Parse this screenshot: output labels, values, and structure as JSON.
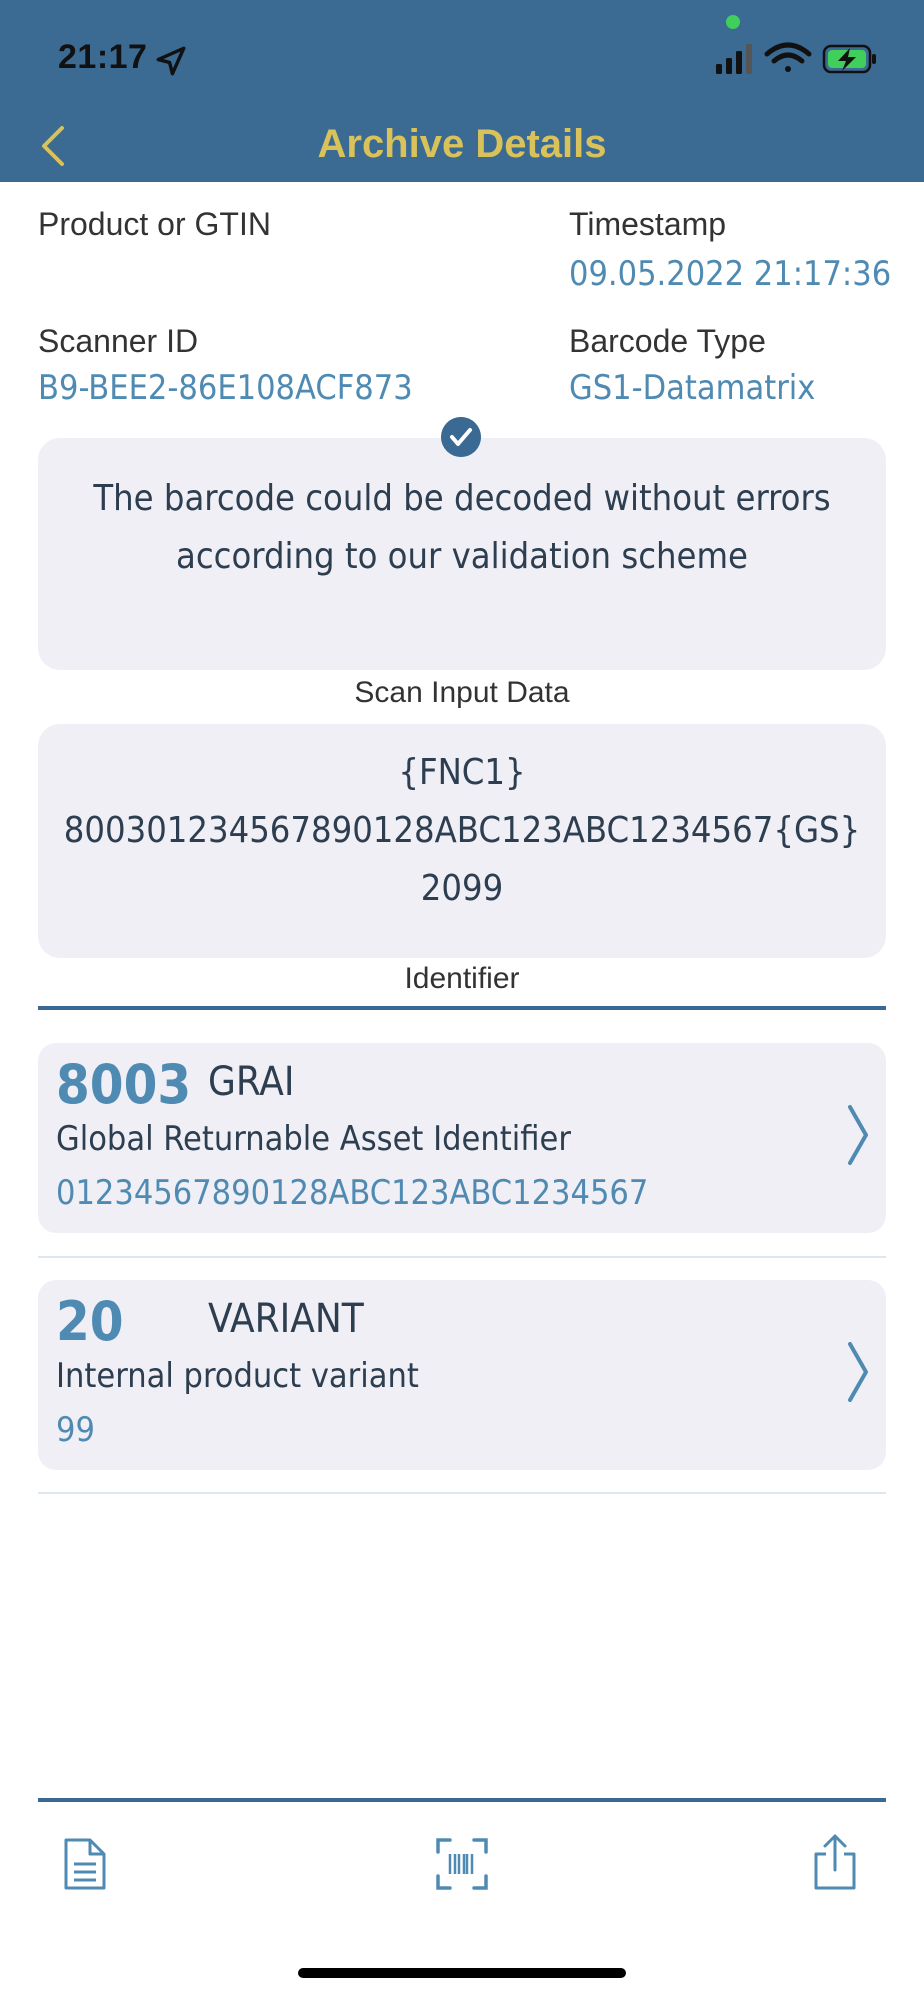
{
  "colors": {
    "nav_bg": "#3b6a93",
    "title": "#d9c25a",
    "accent": "#4f8ab3"
  },
  "status_bar": {
    "time": "21:17"
  },
  "nav": {
    "title": "Archive Details"
  },
  "info": {
    "product_label": "Product or GTIN",
    "timestamp_label": "Timestamp",
    "timestamp_value": "09.05.2022 21:17:36",
    "scanner_label": "Scanner ID",
    "scanner_value": "B9-BEE2-86E108ACF873",
    "barcode_type_label": "Barcode Type",
    "barcode_type_value": "GS1-Datamatrix"
  },
  "validation": {
    "line1": "The barcode could be decoded without errors",
    "line2": "according to our validation scheme"
  },
  "scan_input": {
    "label": "Scan Input Data",
    "line1": "{FNC1}",
    "line2": "800301234567890128ABC123ABC1234567{GS}",
    "line3": "2099"
  },
  "identifier": {
    "label": "Identifier",
    "items": [
      {
        "ai": "8003",
        "short": "GRAI",
        "long": "Global Returnable Asset Identifier",
        "value": "01234567890128ABC123ABC1234567"
      },
      {
        "ai": "20",
        "short": "VARIANT",
        "long": "Internal product variant",
        "value": "99"
      }
    ]
  },
  "toolbar": {
    "icons": [
      "document-icon",
      "barcode-scan-icon",
      "share-icon"
    ]
  }
}
